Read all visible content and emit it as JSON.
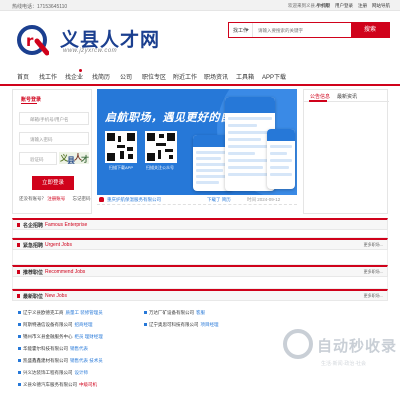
{
  "topbar": {
    "hotline": "热线电话：17153645110",
    "welcome": "欢迎来到义县人才网！",
    "links": [
      "手机版",
      "用户登录",
      "注册",
      "网站导航"
    ]
  },
  "header": {
    "logo_text": "义县人才网",
    "logo_url": "www.jzyxrcw.com",
    "search_type": "找工作",
    "search_placeholder": "请输入要搜索的关键字",
    "search_button": "搜索"
  },
  "nav": {
    "items": [
      "首页",
      "找工作",
      "找企业",
      "找简历",
      "公司",
      "职位专区",
      "附近工作",
      "职场资讯",
      "工具箱",
      "APP下载"
    ]
  },
  "login": {
    "title": "账号登录",
    "username_placeholder": "邮箱/手机号/用户名",
    "password_placeholder": "请输入密码",
    "captcha_placeholder": "验证码",
    "captcha_text": "义县人才",
    "submit": "立即登录",
    "links": [
      "还没有账号？",
      "注册账号",
      "忘记密码"
    ]
  },
  "banner": {
    "slogan": "启航职场，遇见更好的自己",
    "qr1_label": "扫描下载APP",
    "qr2_label": "扫描关注公众号"
  },
  "notice": {
    "company": "重庆护航保温服务有限公司",
    "action": "下载了 简历",
    "time": "时间 2024-09-12"
  },
  "news": {
    "tabs": [
      "公告信息",
      "最新资讯"
    ]
  },
  "sections": {
    "famous": {
      "cn": "名企招聘",
      "en": "Famous Enterprise"
    },
    "urgent": {
      "cn": "紧急招聘",
      "en": "Urgent Jobs",
      "more": "更多职场..."
    },
    "recommend": {
      "cn": "推荐职位",
      "en": "Recommend Jobs",
      "more": "更多职场..."
    },
    "latest": {
      "cn": "最新职位",
      "en": "New Jobs",
      "more": "更多职场..."
    }
  },
  "jobs": [
    {
      "co": "辽宁义县欧德克工商",
      "jobs": "质量工 装修管理员"
    },
    {
      "co": "阿斯特通信设备有限公司",
      "jobs": "招商经理"
    },
    {
      "co": "锦州市义县金融服务中心",
      "jobs": "柜员 理财经理"
    },
    {
      "co": "华能霍尔科技有限公司",
      "jobs": "销售代表"
    },
    {
      "co": "凯盛鑫鑫建材有限公司",
      "jobs": "销售代表 技术员"
    },
    {
      "co": "兴义达装饰工程有限公司",
      "jobs": "设计师"
    },
    {
      "co": "义县众德汽车服务有限公司",
      "jobs": "中级司机"
    },
    {
      "co": "万达厂矿设备有限公司",
      "jobs": "客服"
    },
    {
      "co": "辽宁奥思可科技有限公司",
      "jobs": "项目经理"
    }
  ],
  "watermark": {
    "title": "自动秒收录",
    "subtitle": "生活·新闻·政治·社会"
  },
  "colors": {
    "accent": "#d0021b",
    "brand_blue": "#1b3f8f",
    "banner_blue": "#2678d8"
  }
}
